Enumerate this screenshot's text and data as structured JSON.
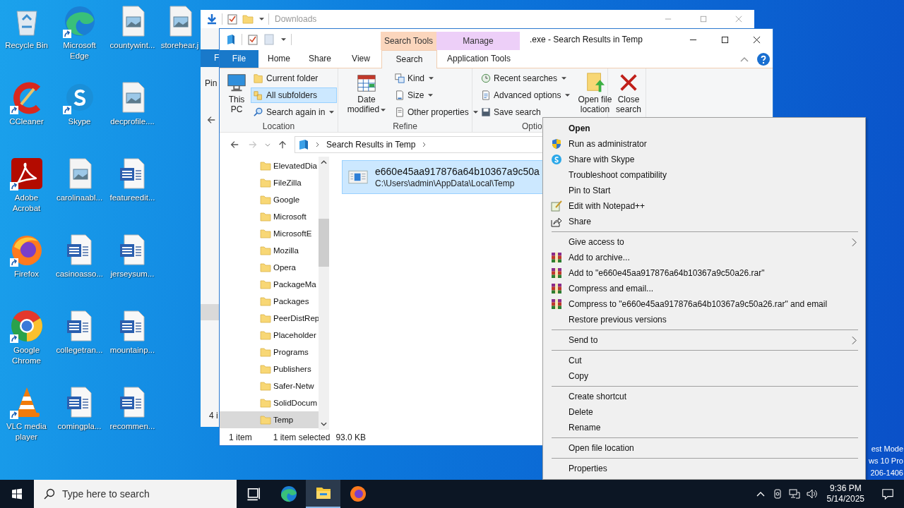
{
  "desktop": {
    "icons": [
      {
        "label": "Recycle Bin",
        "kind": "recycle",
        "shortcut": false
      },
      {
        "label": "CCleaner",
        "kind": "ccleaner",
        "shortcut": true
      },
      {
        "label": "Adobe Acrobat",
        "kind": "acrobat",
        "shortcut": true
      },
      {
        "label": "Firefox",
        "kind": "firefox",
        "shortcut": true
      },
      {
        "label": "Google Chrome",
        "kind": "chrome",
        "shortcut": true
      },
      {
        "label": "VLC media player",
        "kind": "vlc",
        "shortcut": true
      },
      {
        "label": "Microsoft Edge",
        "kind": "edge",
        "shortcut": true
      },
      {
        "label": "Skype",
        "kind": "skype",
        "shortcut": true
      },
      {
        "label": "carolinaabl...",
        "kind": "image",
        "shortcut": false
      },
      {
        "label": "casinoasso...",
        "kind": "word",
        "shortcut": false
      },
      {
        "label": "collegetran...",
        "kind": "word",
        "shortcut": false
      },
      {
        "label": "comingpla...",
        "kind": "word",
        "shortcut": false
      },
      {
        "label": "countywint...",
        "kind": "image",
        "shortcut": false
      },
      {
        "label": "decprofile....",
        "kind": "image",
        "shortcut": false
      },
      {
        "label": "featureedit...",
        "kind": "word",
        "shortcut": false
      },
      {
        "label": "jerseysum...",
        "kind": "word",
        "shortcut": false
      },
      {
        "label": "mountainp...",
        "kind": "word",
        "shortcut": false
      },
      {
        "label": "recommen...",
        "kind": "word",
        "shortcut": false
      },
      {
        "label": "storehear.j",
        "kind": "image",
        "shortcut": false
      }
    ],
    "mode_lines": [
      "est Mode",
      "ws 10 Pro",
      "206-1406"
    ]
  },
  "back_window": {
    "title": "Downloads",
    "file_tab": "F",
    "ribbon_text": "Pin",
    "status": "4 i"
  },
  "explorer": {
    "title": ".exe - Search Results in Temp",
    "context_headers": [
      {
        "label": "Search Tools",
        "kind": "search"
      },
      {
        "label": "Manage",
        "kind": "manage"
      }
    ],
    "tabs": [
      {
        "label": "File",
        "kind": "file",
        "selected": false
      },
      {
        "label": "Home",
        "kind": "plain",
        "selected": false
      },
      {
        "label": "Share",
        "kind": "plain",
        "selected": false
      },
      {
        "label": "View",
        "kind": "plain",
        "selected": false
      },
      {
        "label": "Search",
        "kind": "search",
        "selected": true
      },
      {
        "label": "Application Tools",
        "kind": "manage",
        "selected": false
      }
    ],
    "ribbon": {
      "location": {
        "label": "Location",
        "big": "This PC",
        "small": [
          {
            "label": "Current folder",
            "kind": "folder",
            "selected": false,
            "dropdown": false
          },
          {
            "label": "All subfolders",
            "kind": "subfolders",
            "selected": true,
            "dropdown": false
          },
          {
            "label": "Search again in",
            "kind": "search",
            "selected": false,
            "dropdown": true
          }
        ]
      },
      "refine": {
        "label": "Refine",
        "big": "Date modified",
        "small": [
          {
            "label": "Kind",
            "kind": "kind",
            "selected": false,
            "dropdown": true
          },
          {
            "label": "Size",
            "kind": "size",
            "selected": false,
            "dropdown": true
          },
          {
            "label": "Other properties",
            "kind": "props",
            "selected": false,
            "dropdown": true
          }
        ]
      },
      "options": {
        "label": "Optio",
        "big": "Open file location",
        "small": [
          {
            "label": "Recent searches",
            "kind": "recent",
            "selected": false,
            "dropdown": true
          },
          {
            "label": "Advanced options",
            "kind": "advanced",
            "selected": false,
            "dropdown": true
          },
          {
            "label": "Save search",
            "kind": "save",
            "selected": false,
            "dropdown": false
          }
        ]
      },
      "close": "Close search"
    },
    "address": "Search Results in Temp",
    "folders": [
      {
        "name": "ElevatedDia",
        "selected": false
      },
      {
        "name": "FileZilla",
        "selected": false
      },
      {
        "name": "Google",
        "selected": false
      },
      {
        "name": "Microsoft",
        "selected": false
      },
      {
        "name": "MicrosoftE",
        "selected": false
      },
      {
        "name": "Mozilla",
        "selected": false
      },
      {
        "name": "Opera",
        "selected": false
      },
      {
        "name": "PackageMa",
        "selected": false
      },
      {
        "name": "Packages",
        "selected": false
      },
      {
        "name": "PeerDistRep",
        "selected": false
      },
      {
        "name": "Placeholder",
        "selected": false
      },
      {
        "name": "Programs",
        "selected": false
      },
      {
        "name": "Publishers",
        "selected": false
      },
      {
        "name": "Safer-Netw",
        "selected": false
      },
      {
        "name": "SolidDocum",
        "selected": false
      },
      {
        "name": "Temp",
        "selected": true
      }
    ],
    "result": {
      "name": "e660e45aa917876a64b10367a9c50a",
      "path": "C:\\Users\\admin\\AppData\\Local\\Temp",
      "selected": true
    },
    "status": {
      "count": "1 item",
      "selection": "1 item selected",
      "size": "93.0 KB"
    }
  },
  "context_menu": {
    "groups": [
      {
        "items": [
          {
            "label": "Open",
            "kind": "none",
            "default": true,
            "submenu": false
          },
          {
            "label": "Run as administrator",
            "kind": "shield",
            "default": false,
            "submenu": false
          },
          {
            "label": "Share with Skype",
            "kind": "skype",
            "default": false,
            "submenu": false
          },
          {
            "label": "Troubleshoot compatibility",
            "kind": "none",
            "default": false,
            "submenu": false
          },
          {
            "label": "Pin to Start",
            "kind": "none",
            "default": false,
            "submenu": false
          },
          {
            "label": "Edit with Notepad++",
            "kind": "notepad",
            "default": false,
            "submenu": false
          },
          {
            "label": "Share",
            "kind": "share",
            "default": false,
            "submenu": false
          }
        ]
      },
      {
        "items": [
          {
            "label": "Give access to",
            "kind": "none",
            "default": false,
            "submenu": true
          },
          {
            "label": "Add to archive...",
            "kind": "archive",
            "default": false,
            "submenu": false
          },
          {
            "label": "Add to \"e660e45aa917876a64b10367a9c50a26.rar\"",
            "kind": "archive",
            "default": false,
            "submenu": false
          },
          {
            "label": "Compress and email...",
            "kind": "archive",
            "default": false,
            "submenu": false
          },
          {
            "label": "Compress to \"e660e45aa917876a64b10367a9c50a26.rar\" and email",
            "kind": "archive",
            "default": false,
            "submenu": false
          },
          {
            "label": "Restore previous versions",
            "kind": "none",
            "default": false,
            "submenu": false
          }
        ]
      },
      {
        "items": [
          {
            "label": "Send to",
            "kind": "none",
            "default": false,
            "submenu": true
          }
        ]
      },
      {
        "items": [
          {
            "label": "Cut",
            "kind": "none",
            "default": false,
            "submenu": false
          },
          {
            "label": "Copy",
            "kind": "none",
            "default": false,
            "submenu": false
          }
        ]
      },
      {
        "items": [
          {
            "label": "Create shortcut",
            "kind": "none",
            "default": false,
            "submenu": false
          },
          {
            "label": "Delete",
            "kind": "none",
            "default": false,
            "submenu": false
          },
          {
            "label": "Rename",
            "kind": "none",
            "default": false,
            "submenu": false
          }
        ]
      },
      {
        "items": [
          {
            "label": "Open file location",
            "kind": "none",
            "default": false,
            "submenu": false
          }
        ]
      },
      {
        "items": [
          {
            "label": "Properties",
            "kind": "none",
            "default": false,
            "submenu": false
          }
        ]
      }
    ]
  },
  "taskbar": {
    "search": {
      "placeholder": "Type here to search"
    },
    "apps": [
      {
        "kind": "taskview",
        "selected": false
      },
      {
        "kind": "edge",
        "selected": false
      },
      {
        "kind": "explorer",
        "selected": true
      },
      {
        "kind": "firefox",
        "selected": false
      }
    ],
    "time": "9:36 PM",
    "date": "5/14/2025"
  }
}
